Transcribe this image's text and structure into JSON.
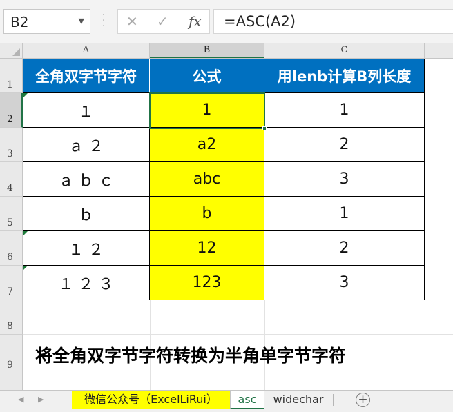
{
  "formula_bar": {
    "name_box": "B2",
    "name_box_icon": "chevron-down-icon",
    "cancel_icon": "✕",
    "enter_icon": "✓",
    "fx_label": "fx",
    "formula": "=ASC(A2)"
  },
  "columns": [
    "A",
    "B",
    "C"
  ],
  "selected_column": "B",
  "rows": [
    "1",
    "2",
    "3",
    "4",
    "5",
    "6",
    "7",
    "8",
    "9"
  ],
  "selected_row": "2",
  "table": {
    "headers": [
      "全角双字节字符",
      "公式",
      "用lenb计算B列长度"
    ],
    "rows": [
      [
        "１",
        "1",
        "1"
      ],
      [
        "ａ ２",
        "a2",
        "2"
      ],
      [
        "ａ ｂ ｃ",
        "abc",
        "3"
      ],
      [
        "ｂ",
        "b",
        "1"
      ],
      [
        "１ ２",
        "12",
        "2"
      ],
      [
        "１ ２ ３",
        "123",
        "3"
      ]
    ]
  },
  "note": "将全角双字节字符转换为半角单字节字符",
  "sheet_tabs": {
    "prev_icon": "◀",
    "next_icon": "▶",
    "tabs": [
      "微信公众号（ExcelLiRui）",
      "asc",
      "widechar"
    ],
    "active": "asc",
    "add_icon": "+"
  },
  "colors": {
    "header_fill": "#0070c0",
    "formula_fill": "#ffff00",
    "accent": "#217346"
  }
}
